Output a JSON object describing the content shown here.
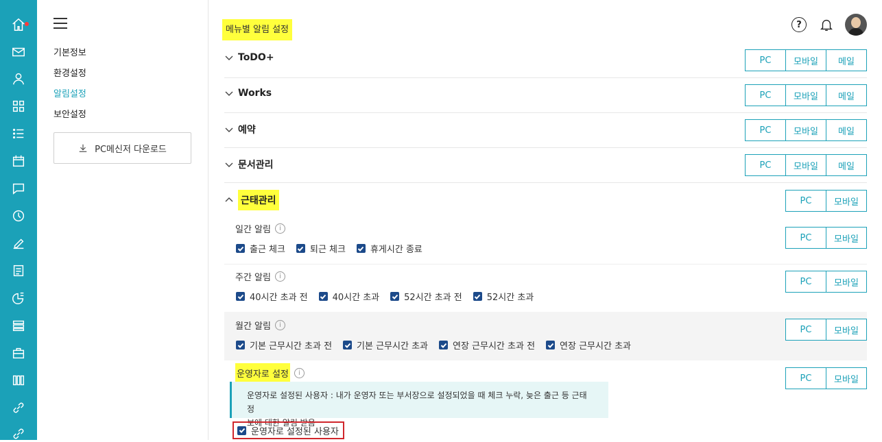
{
  "rail": {
    "icons": [
      "home-icon",
      "mail-icon",
      "person-icon",
      "grid-icon",
      "list-icon",
      "calendar-icon",
      "chat-icon",
      "clock-icon",
      "edit-icon",
      "board-icon",
      "chart-icon",
      "stack-icon",
      "briefcase-icon",
      "library-icon",
      "link-icon",
      "link2-icon"
    ],
    "accent": "#1ba1b8",
    "badge_color": "#ff3b3b"
  },
  "sidebar": {
    "items": [
      {
        "label": "기본정보",
        "active": false
      },
      {
        "label": "환경설정",
        "active": false
      },
      {
        "label": "알림설정",
        "active": true
      },
      {
        "label": "보안설정",
        "active": false
      }
    ],
    "download_label": "PC메신저 다운로드"
  },
  "header": {
    "title": "메뉴별 알림 설정",
    "help_label": "?"
  },
  "buttons": {
    "pc": "PC",
    "mobile": "모바일",
    "mail": "메일"
  },
  "sections": [
    {
      "label": "ToDO+"
    },
    {
      "label": "Works"
    },
    {
      "label": "예약"
    },
    {
      "label": "문서관리"
    }
  ],
  "attendance": {
    "label": "근태관리",
    "daily": {
      "title": "일간 알림",
      "checks": [
        "출근 체크",
        "퇴근 체크",
        "휴게시간 종료"
      ]
    },
    "weekly": {
      "title": "주간 알림",
      "checks": [
        "40시간 초과 전",
        "40시간 초과",
        "52시간 초과 전",
        "52시간 초과"
      ]
    },
    "monthly": {
      "title": "월간 알림",
      "checks": [
        "기본 근무시간 초과 전",
        "기본 근무시간 초과",
        "연장 근무시간 초과 전",
        "연장 근무시간 초과"
      ]
    },
    "operator": {
      "title": "운영자로 설정",
      "tip_line1": "운영자로 설정된 사용자 : 내가 운영자 또는 부서장으로 설정되었을 때 체크 누락, 늦은 출근 등 근태정",
      "tip_line2": "보에 대한 알림 받음",
      "check": "운영자로 설정된 사용자"
    }
  }
}
